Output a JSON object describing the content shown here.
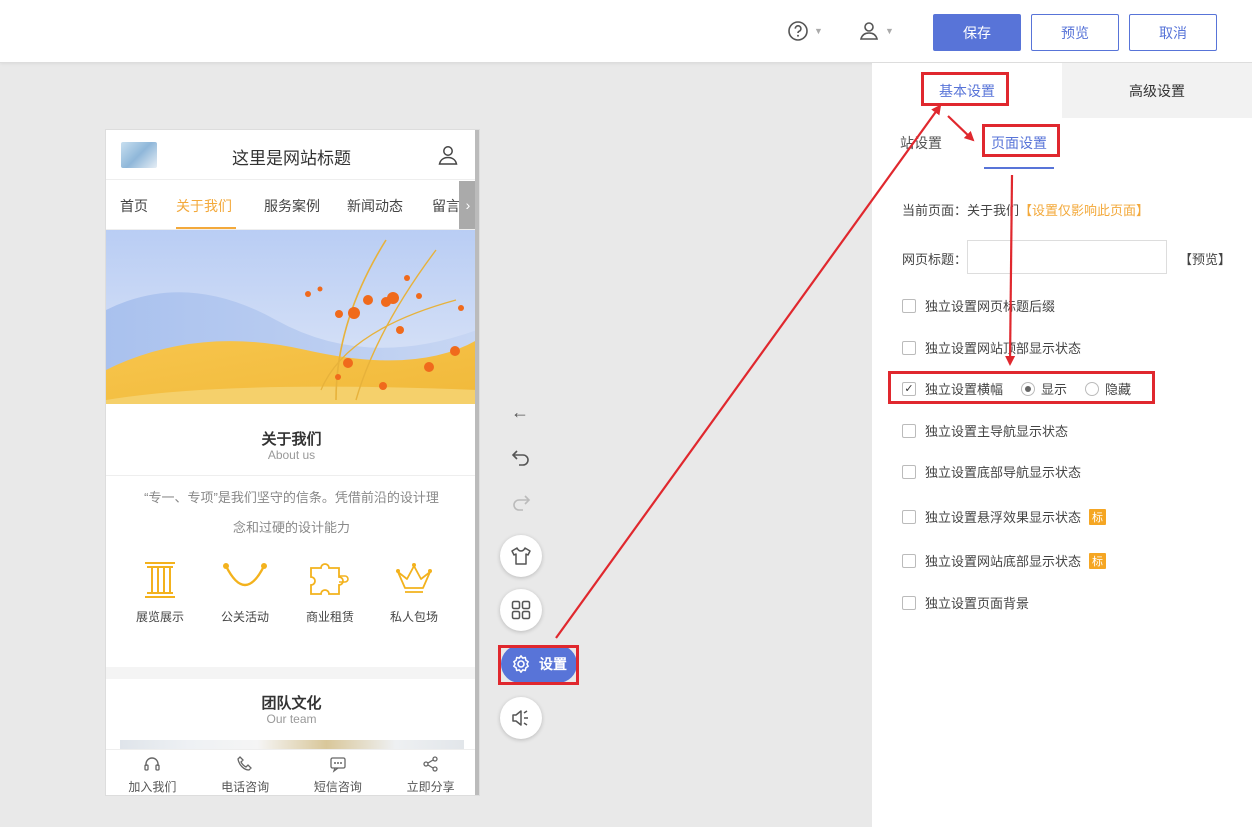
{
  "toolbar": {
    "save_label": "保存",
    "preview_label": "预览",
    "cancel_label": "取消"
  },
  "phone": {
    "site_title": "这里是网站标题",
    "nav": [
      "首页",
      "关于我们",
      "服务案例",
      "新闻动态",
      "留言板"
    ],
    "nav_active": "关于我们",
    "about": {
      "title": "关于我们",
      "subtitle": "About us",
      "text_line1": "“专一、专项”是我们坚守的信条。凭借前沿的设计理",
      "text_line2": "念和过硬的设计能力"
    },
    "features": [
      "展览展示",
      "公关活动",
      "商业租赁",
      "私人包场"
    ],
    "team": {
      "title": "团队文化",
      "subtitle": "Our team"
    },
    "footer": [
      "加入我们",
      "电话咨询",
      "短信咨询",
      "立即分享"
    ],
    "accent_color": "#f3a93b"
  },
  "tools": {
    "settings_label": "设置"
  },
  "panel": {
    "tabs": [
      "基本设置",
      "高级设置"
    ],
    "subtabs": [
      "网站设置",
      "页面设置"
    ],
    "subtab_visible_partial": "站设置",
    "current_page_label": "当前页面：关于我们",
    "current_page_note": "【设置仅影响此页面】",
    "page_title_label": "网页标题：",
    "page_title_value": "",
    "page_title_preview": "【预览】",
    "options": [
      {
        "label": "独立设置网页标题后缀",
        "checked": false
      },
      {
        "label": "独立设置网站顶部显示状态",
        "checked": false
      },
      {
        "label": "独立设置横幅",
        "checked": true
      },
      {
        "label": "独立设置主导航显示状态",
        "checked": false
      },
      {
        "label": "独立设置底部导航显示状态",
        "checked": false
      },
      {
        "label": "独立设置悬浮效果显示状态",
        "checked": false,
        "badge": "标"
      },
      {
        "label": "独立设置网站底部显示状态",
        "checked": false,
        "badge": "标"
      },
      {
        "label": "独立设置页面背景",
        "checked": false
      }
    ],
    "banner_radio": {
      "show": "显示",
      "hide": "隐藏",
      "selected": "显示"
    },
    "accent_color": "#5874d8"
  },
  "annotation_color": "#e0282e"
}
